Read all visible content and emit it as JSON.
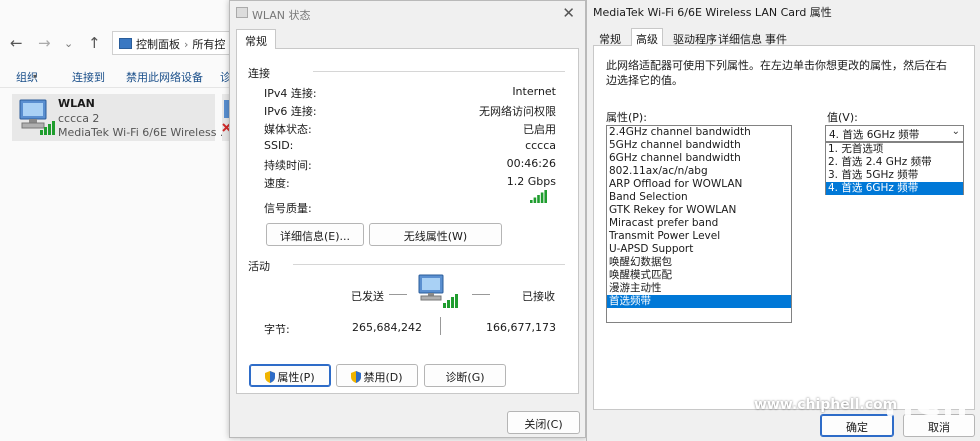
{
  "explorer": {
    "address": [
      "控制面板",
      "所有控"
    ],
    "commands": [
      "组织",
      "连接到",
      "禁用此网络设备",
      "诊"
    ],
    "adapter": {
      "name": "WLAN",
      "ssid": "cccca 2",
      "description": "MediaTek Wi-Fi 6/6E Wireless ..."
    }
  },
  "wlan_status": {
    "title": "WLAN 状态",
    "tab": "常规",
    "connection_group": "连接",
    "rows": [
      {
        "label": "IPv4 连接:",
        "value": "Internet"
      },
      {
        "label": "IPv6 连接:",
        "value": "无网络访问权限"
      },
      {
        "label": "媒体状态:",
        "value": "已启用"
      },
      {
        "label": "SSID:",
        "value": "cccca"
      },
      {
        "label": "持续时间:",
        "value": "00:46:26"
      },
      {
        "label": "速度:",
        "value": "1.2 Gbps"
      }
    ],
    "signal_label": "信号质量:",
    "signal_bars": 4,
    "details_button": "详细信息(E)...",
    "wireless_button": "无线属性(W)",
    "activity_group": "活动",
    "sent_label": "已发送",
    "received_label": "已接收",
    "bytes_label": "字节:",
    "bytes_sent": "265,684,242",
    "bytes_received": "166,677,173",
    "properties_button": "属性(P)",
    "disable_button": "禁用(D)",
    "diagnose_button": "诊断(G)",
    "close_button": "关闭(C)"
  },
  "properties": {
    "title": "MediaTek Wi-Fi 6/6E Wireless LAN Card 属性",
    "tabs": [
      "常规",
      "高级",
      "驱动程序",
      "详细信息",
      "事件"
    ],
    "active_tab": "高级",
    "description": "此网络适配器可使用下列属性。在左边单击你想更改的属性，然后在右边选择它的值。",
    "property_label": "属性(P):",
    "property_items": [
      "2.4GHz channel bandwidth",
      "5GHz channel bandwidth",
      "6GHz channel bandwidth",
      "802.11ax/ac/n/abg",
      "ARP Offload for WOWLAN",
      "Band Selection",
      "GTK Rekey for WOWLAN",
      "Miracast prefer band",
      "Transmit Power Level",
      "U-APSD Support",
      "唤醒幻数据包",
      "唤醒模式匹配",
      "漫游主动性",
      "首选频带"
    ],
    "selected_property": "首选频带",
    "value_label": "值(V):",
    "value_selected": "4. 首选 6GHz 频带",
    "value_options": [
      "1. 无首选项",
      "2. 首选 2.4 GHz 频带",
      "3. 首选 5GHz 频带",
      "4. 首选 6GHz 频带"
    ],
    "ok_button": "确定",
    "cancel_button": "取消"
  },
  "watermark": {
    "url": "www.chiphell.com",
    "logo_text": "chip hell"
  },
  "colors": {
    "selection": "#0078d7",
    "signal": "#1f9d2e",
    "accent_border": "#2e6cc8"
  }
}
